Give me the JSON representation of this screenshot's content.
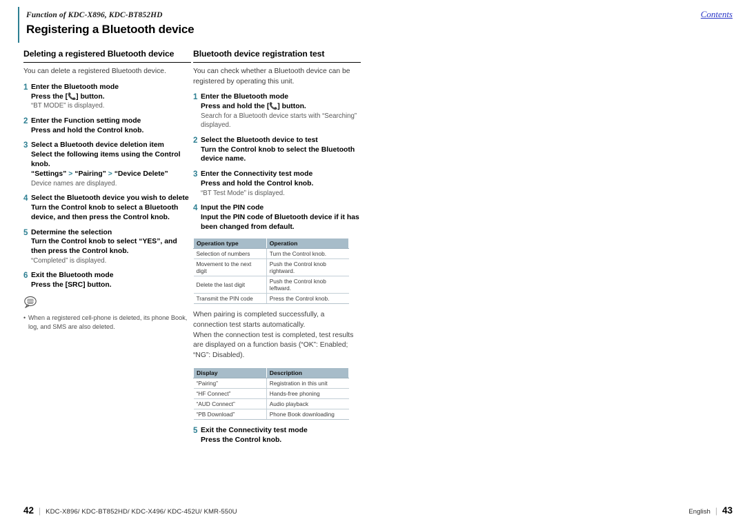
{
  "header": {
    "function_line": "Function of KDC-X896, KDC-BT852HD",
    "title": "Registering a Bluetooth device",
    "contents_link": "Contents"
  },
  "left_column": {
    "heading": "Deleting a registered Bluetooth device",
    "intro": "You can delete a registered Bluetooth device.",
    "steps": [
      {
        "num": "1",
        "title": "Enter the Bluetooth mode",
        "action_pre": "Press the [",
        "action_post": "] button.",
        "has_phone_icon": true,
        "note": "“BT MODE” is displayed."
      },
      {
        "num": "2",
        "title": "Enter the Function setting mode",
        "action": "Press and hold the Control knob."
      },
      {
        "num": "3",
        "title": "Select a Bluetooth device deletion item",
        "action": "Select the following items using the Control knob.",
        "path": [
          "“Settings”",
          "“Pairing”",
          "“Device Delete”"
        ],
        "path_separator": ">",
        "note": "Device names are displayed."
      },
      {
        "num": "4",
        "title": "Select the Bluetooth device you wish to delete",
        "action": "Turn the Control knob to select a Bluetooth device, and then press the Control knob."
      },
      {
        "num": "5",
        "title": "Determine the selection",
        "action": "Turn the Control knob to select “YES”, and then press the Control knob.",
        "note": "“Completed” is displayed."
      },
      {
        "num": "6",
        "title": "Exit the Bluetooth mode",
        "action": "Press the [SRC] button."
      }
    ],
    "note_icon": "note-bubble-icon",
    "note_bullets": [
      "When a registered cell-phone is deleted, its phone Book, log, and SMS are also deleted."
    ]
  },
  "right_column": {
    "heading": "Bluetooth device registration test",
    "intro": "You can check whether a Bluetooth device can be registered by operating this unit.",
    "steps_part1": [
      {
        "num": "1",
        "title": "Enter the Bluetooth mode",
        "action_pre": "Press and hold the [",
        "action_post": "] button.",
        "has_phone_icon": true,
        "note": "Search for a Bluetooth device starts with “Searching” displayed."
      },
      {
        "num": "2",
        "title": "Select the Bluetooth device to test",
        "action": "Turn the Control knob to select the Bluetooth device name."
      },
      {
        "num": "3",
        "title": "Enter the Connectivity test mode",
        "action": "Press and hold the Control knob.",
        "note": "“BT Test Mode” is displayed."
      },
      {
        "num": "4",
        "title": "Input the PIN code",
        "action": "Input the PIN code of Bluetooth device if it has been changed from default."
      }
    ],
    "operation_table": {
      "headers": [
        "Operation type",
        "Operation"
      ],
      "rows": [
        [
          "Selection of numbers",
          "Turn the Control knob."
        ],
        [
          "Movement to the next digit",
          "Push the Control knob rightward."
        ],
        [
          "Delete the last digit",
          "Push the Control knob leftward."
        ],
        [
          "Transmit the PIN code",
          "Press the Control knob."
        ]
      ]
    },
    "paragraph_1": "When pairing is completed successfully, a connection test starts automatically.",
    "paragraph_2": "When the connection test is completed, test results are displayed on a function basis (“OK”: Enabled; “NG”: Disabled).",
    "display_table": {
      "headers": [
        "Display",
        "Description"
      ],
      "rows": [
        [
          "“Pairing”",
          "Registration in this unit"
        ],
        [
          "“HF Connect”",
          "Hands-free phoning"
        ],
        [
          "“AUD Connect”",
          "Audio playback"
        ],
        [
          "“PB Download”",
          "Phone Book downloading"
        ]
      ]
    },
    "steps_part2": [
      {
        "num": "5",
        "title": "Exit the Connectivity test mode",
        "action": "Press the Control knob."
      }
    ]
  },
  "footer": {
    "page_left": "42",
    "models": "KDC-X896/ KDC-BT852HD/ KDC-X496/ KDC-452U/ KMR-550U",
    "language": "English",
    "page_right": "43"
  },
  "colors": {
    "accent_teal": "#2d7f92",
    "table_header_bg": "#a7bcc9",
    "link_blue": "#2b37c8"
  }
}
